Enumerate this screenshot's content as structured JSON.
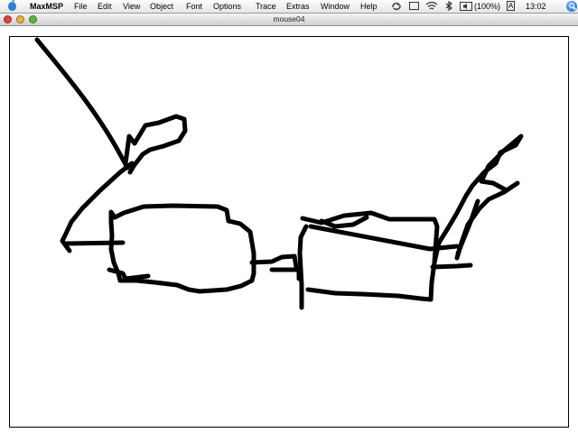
{
  "menubar": {
    "app_name": "MaxMSP",
    "items": [
      "File",
      "Edit",
      "View",
      "Object",
      "Font",
      "Options",
      "Trace",
      "Extras",
      "Window",
      "Help"
    ],
    "battery": "(100%)",
    "clock": "13:02",
    "input_menu": "A"
  },
  "window": {
    "title": "mouse04"
  },
  "colors": {
    "stroke": "#000000",
    "canvas_bg": "#ffffff",
    "close": "#e0443a",
    "minimize": "#e8b33a",
    "zoom": "#5fb73a"
  },
  "icons": [
    "apple-icon",
    "sync-icon",
    "bluetooth-icon",
    "wifi-icon",
    "volume-icon",
    "battery-icon",
    "spotlight-icon"
  ]
}
